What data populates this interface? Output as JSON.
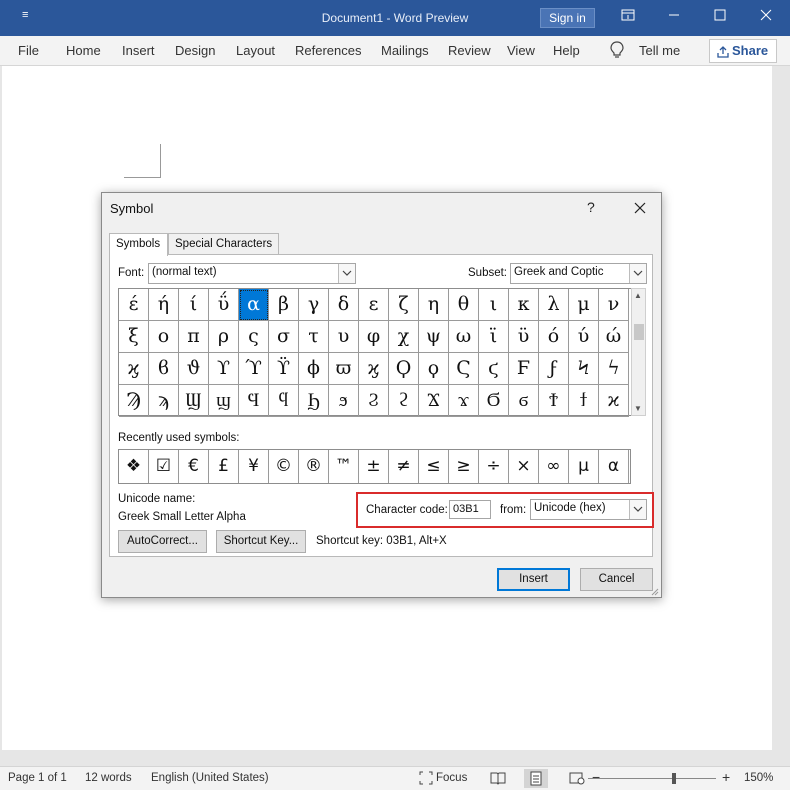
{
  "window": {
    "title": "Document1  -  Word Preview",
    "signin": "Sign in",
    "qa_icon": "≡"
  },
  "ribbon": {
    "tabs": [
      "File",
      "Home",
      "Insert",
      "Design",
      "Layout",
      "References",
      "Mailings",
      "Review",
      "View",
      "Help"
    ],
    "tell_me": "Tell me",
    "share": "Share"
  },
  "dialog": {
    "title": "Symbol",
    "help": "?",
    "tabs": [
      "Symbols",
      "Special Characters"
    ],
    "font_label": "Font:",
    "font_value": "(normal text)",
    "subset_label": "Subset:",
    "subset_value": "Greek and Coptic",
    "symbols": [
      [
        "έ",
        "ή",
        "ί",
        "ΰ",
        "α",
        "β",
        "γ",
        "δ",
        "ε",
        "ζ",
        "η",
        "θ",
        "ι",
        "κ",
        "λ",
        "μ",
        "ν"
      ],
      [
        "ξ",
        "ο",
        "π",
        "ρ",
        "ς",
        "σ",
        "τ",
        "υ",
        "φ",
        "χ",
        "ψ",
        "ω",
        "ϊ",
        "ϋ",
        "ό",
        "ύ",
        "ώ"
      ],
      [
        "ϗ",
        "ϐ",
        "ϑ",
        "ϒ",
        "ϓ",
        "ϔ",
        "ϕ",
        "ϖ",
        "ϗ",
        "Ϙ",
        "ϙ",
        "Ϛ",
        "ϛ",
        "Ϝ",
        "ϝ",
        "Ϟ",
        "ϟ"
      ],
      [
        "Ϡ",
        "ϡ",
        "Ϣ",
        "ϣ",
        "Ϥ",
        "ϥ",
        "Ϧ",
        "ϧ",
        "Ϩ",
        "ϩ",
        "Ϫ",
        "ϫ",
        "Ϭ",
        "ϭ",
        "Ϯ",
        "ϯ",
        "ϰ"
      ]
    ],
    "selected": {
      "row": 0,
      "col": 4
    },
    "recent_label": "Recently used symbols:",
    "recent": [
      "❖",
      "☑",
      "€",
      "£",
      "¥",
      "©",
      "®",
      "™",
      "±",
      "≠",
      "≤",
      "≥",
      "÷",
      "×",
      "∞",
      "µ",
      "α"
    ],
    "unicode_name_label": "Unicode name:",
    "unicode_name": "Greek Small Letter Alpha",
    "char_code_label": "Character code:",
    "char_code": "03B1",
    "from_label": "from:",
    "from_value": "Unicode (hex)",
    "autocorrect": "AutoCorrect...",
    "shortcut_key_btn": "Shortcut Key...",
    "shortcut_text": "Shortcut key: 03B1, Alt+X",
    "insert": "Insert",
    "cancel": "Cancel"
  },
  "status": {
    "page": "Page 1 of 1",
    "words": "12 words",
    "language": "English (United States)",
    "focus": "Focus",
    "zoom_minus": "−",
    "zoom_plus": "+",
    "zoom": "150%"
  }
}
